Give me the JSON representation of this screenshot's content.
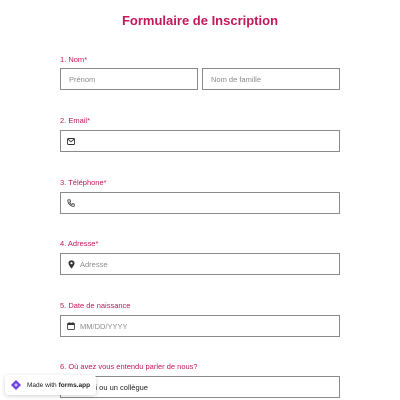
{
  "form": {
    "title": "Formulaire de Inscription"
  },
  "questions": {
    "name": {
      "label": "1. Nom",
      "required_mark": "*",
      "first_placeholder": "Prénom",
      "last_placeholder": "Nom de famille"
    },
    "email": {
      "label": "2. Email",
      "required_mark": "*",
      "icon": "envelope-icon",
      "value": ""
    },
    "phone": {
      "label": "3. Téléphone",
      "required_mark": "*",
      "icon": "phone-icon",
      "value": ""
    },
    "address": {
      "label": "4. Adresse",
      "required_mark": "*",
      "icon": "location-pin-icon",
      "placeholder": "Adresse"
    },
    "birthdate": {
      "label": "5. Date de naissance",
      "icon": "calendar-icon",
      "placeholder": "MM/DD/YYYY"
    },
    "referral": {
      "label": "6. Où avez vous entendu parler de nous?",
      "visible_text": "ami ou un collègue"
    }
  },
  "badge": {
    "prefix": "Made with",
    "brand": "forms.app",
    "icon": "forms-app-logo-icon"
  },
  "colors": {
    "accent": "#c2185b",
    "border": "#8a8a8a",
    "placeholder": "#8c8c8c",
    "badge_logo": "#6c3fe0"
  }
}
